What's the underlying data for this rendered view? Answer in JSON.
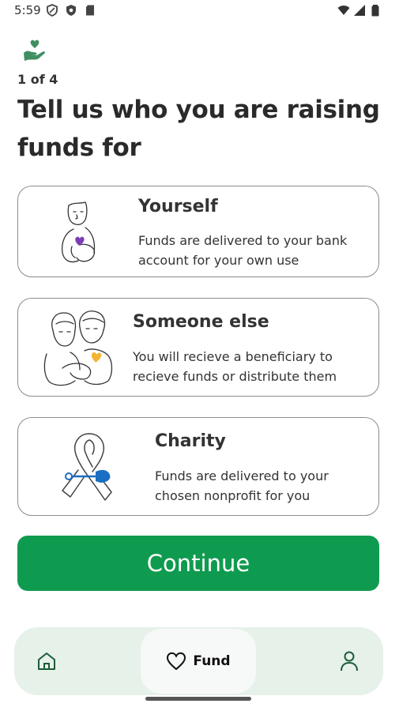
{
  "status_bar": {
    "time": "5:59"
  },
  "header": {
    "step": "1 of 4",
    "title": "Tell us who you are raising funds for"
  },
  "options": [
    {
      "title": "Yourself",
      "description": "Funds are delivered to your bank account for your own use"
    },
    {
      "title": "Someone else",
      "description": "You will recieve a beneficiary to recieve funds or distribute them"
    },
    {
      "title": "Charity",
      "description": "Funds are delivered to your chosen nonprofit for you"
    }
  ],
  "continue_label": "Continue",
  "nav": {
    "fund_label": "Fund"
  },
  "colors": {
    "brand_green": "#0f9b4f",
    "nav_bg": "#e6f1ea",
    "logo_green": "#3f8f63",
    "heart_purple": "#7a3fb3",
    "heart_yellow": "#f2b632",
    "pin_blue": "#1b6fc2"
  },
  "icons": [
    "shield-icon",
    "play-protect-icon",
    "sd-card-icon",
    "wifi-icon",
    "signal-icon",
    "battery-icon",
    "hand-heart-logo-icon",
    "home-icon",
    "heart-icon",
    "person-icon"
  ]
}
